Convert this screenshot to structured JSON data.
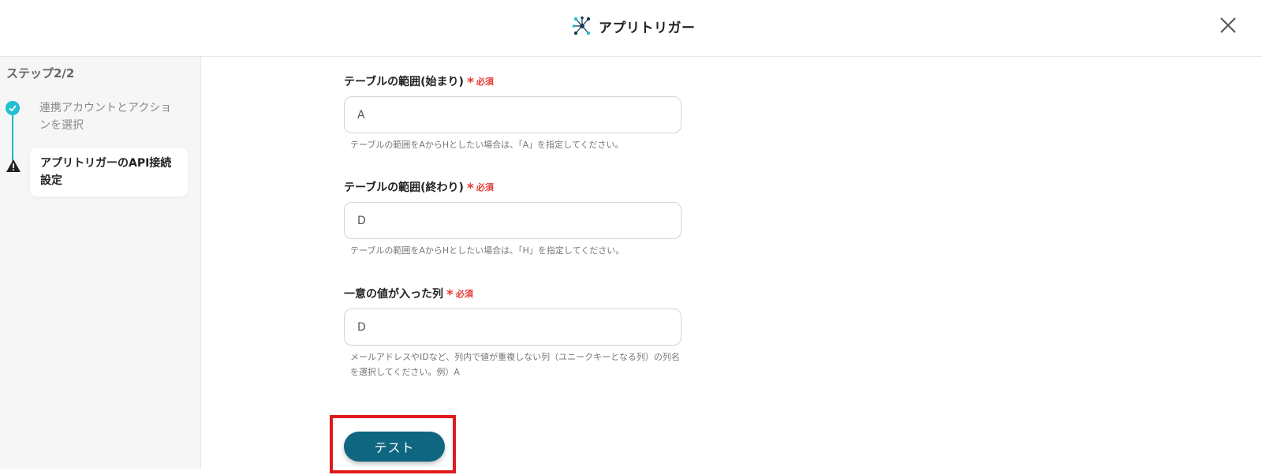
{
  "header": {
    "title": "アプリトリガー",
    "app_icon": "network-nodes-icon",
    "close_icon": "close-icon"
  },
  "sidebar": {
    "step_count": "ステップ2/2",
    "steps": [
      {
        "label": "連携アカウントとアクションを選択",
        "status": "complete",
        "icon": "check-circle-icon"
      },
      {
        "label": "アプリトリガーのAPI接続設定",
        "status": "warning",
        "icon": "warning-icon",
        "active": true
      }
    ]
  },
  "form": {
    "required_text": "必須",
    "required_mark": "*",
    "fields": [
      {
        "label": "テーブルの範囲(始まり)",
        "value": "A",
        "help": "テーブルの範囲をAからHとしたい場合は、「A」を指定してください。"
      },
      {
        "label": "テーブルの範囲(終わり)",
        "value": "D",
        "help": "テーブルの範囲をAからHとしたい場合は、「H」を指定してください。"
      },
      {
        "label": "一意の値が入った列",
        "value": "D",
        "help": "メールアドレスやIDなど、列内で値が重複しない列（ユニークキーとなる列）の列名を選択してください。例）A"
      }
    ],
    "test_button": "テスト"
  },
  "colors": {
    "accent_teal": "#22bfd0",
    "button_bg": "#0f6680",
    "required_red": "#e53935",
    "highlight_red": "#e01b1b"
  }
}
